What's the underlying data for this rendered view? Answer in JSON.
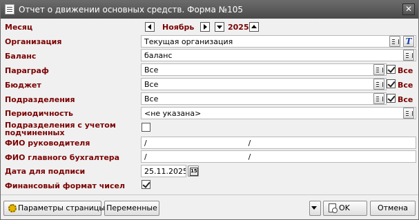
{
  "window": {
    "title": "Отчет о движении основных средств. Форма №105",
    "close_glyph": "✕"
  },
  "labels": {
    "month": "Месяц",
    "organization": "Организация",
    "balance": "Баланс",
    "paragraph": "Параграф",
    "budget": "Бюджет",
    "departments": "Подразделения",
    "periodicity": "Периодичность",
    "subordinate_line1": "Подразделения с учетом",
    "subordinate_line2": "подчиненных",
    "head_name": "ФИО руководителя",
    "accountant_name": "ФИО главного бухгалтера",
    "sign_date": "Дата для подписи",
    "number_format": "Финансовый формат чисел"
  },
  "values": {
    "month": "Ноябрь",
    "year": "2025",
    "organization": "Текущая организация",
    "balance": "баланс",
    "paragraph": "Все",
    "budget": "Все",
    "departments": "Все",
    "periodicity": "<не указана>",
    "head_name": "/                                          /",
    "accountant_name": "/                                          /",
    "sign_date": "25.11.2025"
  },
  "checkboxes": {
    "all_label": "Все",
    "paragraph_all": true,
    "budget_all": true,
    "departments_all": true,
    "subordinate": false,
    "number_format": true
  },
  "buttons": {
    "page_params": "Параметры страницы",
    "variables": "Переменные",
    "ok": "OK",
    "cancel": "Отмена",
    "t_button": "T"
  },
  "colors": {
    "label": "#7a0000",
    "titlebar": "#555555"
  }
}
